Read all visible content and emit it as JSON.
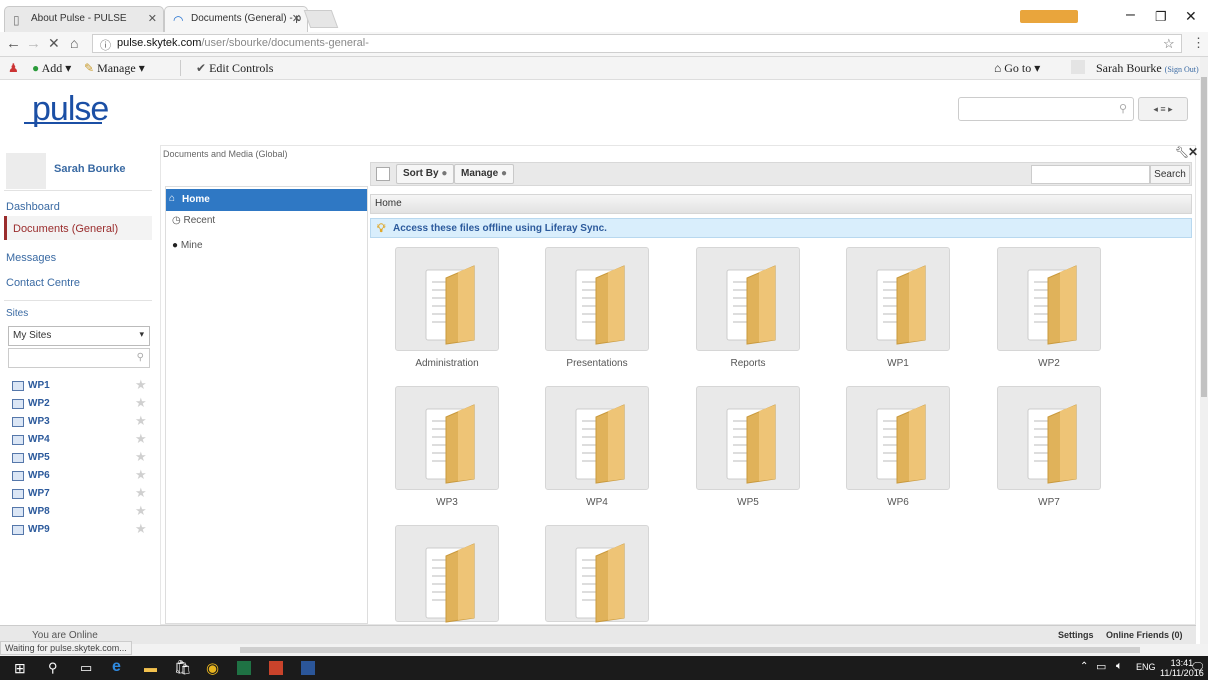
{
  "browser": {
    "tabs": [
      {
        "title": "About Pulse - PULSE"
      },
      {
        "title": "Documents (General) - p"
      }
    ],
    "url_host": "pulse.skytek.com",
    "url_path": "/user/sbourke/documents-general-"
  },
  "dockbar": {
    "add_label": "Add",
    "manage_label": "Manage",
    "edit_controls_label": "Edit Controls",
    "goto_label": "Go to",
    "user_name": "Sarah Bourke",
    "sign_out": "(Sign Out)"
  },
  "logo_text": "pulse",
  "user": {
    "name": "Sarah Bourke"
  },
  "left_nav": {
    "items": [
      {
        "label": "Dashboard"
      },
      {
        "label": "Documents (General)"
      },
      {
        "label": "Messages"
      },
      {
        "label": "Contact Centre"
      }
    ],
    "sites_heading": "Sites",
    "sites_select": "My Sites",
    "sites": [
      "WP1",
      "WP2",
      "WP3",
      "WP4",
      "WP5",
      "WP6",
      "WP7",
      "WP8",
      "WP9"
    ]
  },
  "portlet": {
    "title": "Documents and Media (Global)",
    "sort_by": "Sort By",
    "manage": "Manage",
    "search_button": "Search",
    "folder_nav": [
      {
        "label": "Home"
      },
      {
        "label": "Recent"
      },
      {
        "label": "Mine"
      }
    ],
    "breadcrumb": "Home",
    "notice": "Access these files offline using Liferay Sync.",
    "folders": [
      "Administration",
      "Presentations",
      "Reports",
      "WP1",
      "WP2",
      "WP3",
      "WP4",
      "WP5",
      "WP6",
      "WP7",
      "",
      ""
    ]
  },
  "footer": {
    "online_text": "You are Online",
    "settings": "Settings",
    "online_friends": "Online Friends (0)",
    "status_text": "Waiting for pulse.skytek.com..."
  },
  "taskbar": {
    "lang": "ENG",
    "time": "13:41",
    "date": "11/11/2016"
  }
}
